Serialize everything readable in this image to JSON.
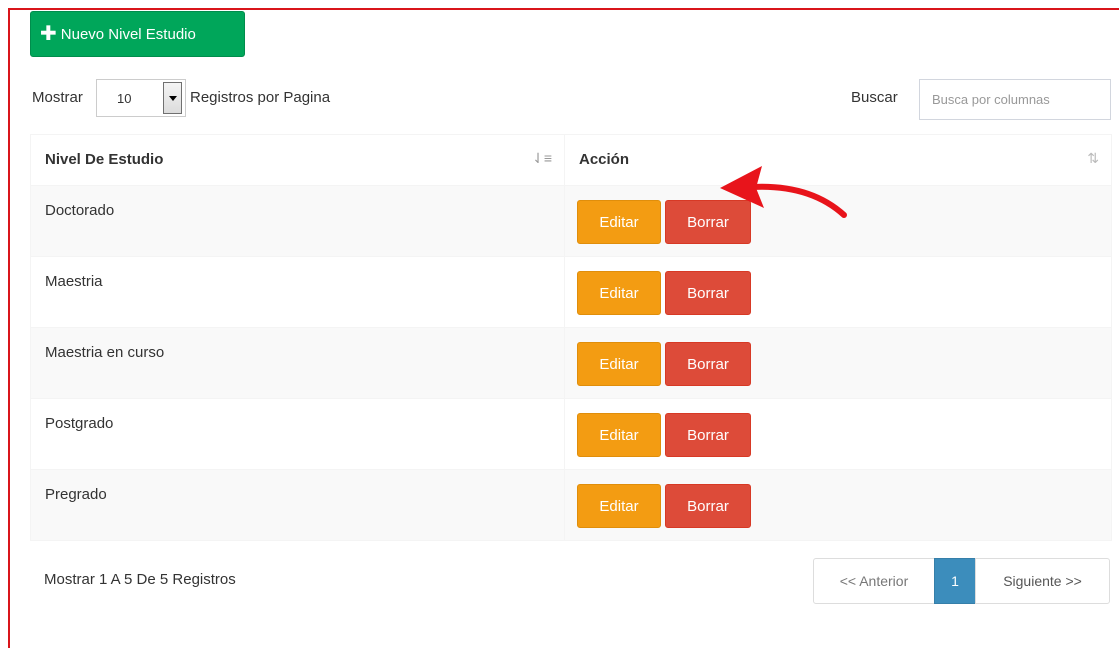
{
  "toolbar": {
    "new_button_label": "Nuevo Nivel Estudio",
    "new_button_icon": "plus-icon"
  },
  "length_control": {
    "prefix": "Mostrar",
    "selected": "10",
    "suffix": "Registros por Pagina"
  },
  "search": {
    "label": "Buscar",
    "placeholder": "Busca por columnas",
    "value": ""
  },
  "table": {
    "columns": [
      {
        "label": "Nivel De Estudio",
        "sort_icon": "sort-amount-asc-icon"
      },
      {
        "label": "Acción",
        "sort_icon": "sort-icon"
      }
    ],
    "rows": [
      {
        "name": "Doctorado",
        "edit": "Editar",
        "delete": "Borrar"
      },
      {
        "name": "Maestria",
        "edit": "Editar",
        "delete": "Borrar"
      },
      {
        "name": "Maestria en curso",
        "edit": "Editar",
        "delete": "Borrar"
      },
      {
        "name": "Postgrado",
        "edit": "Editar",
        "delete": "Borrar"
      },
      {
        "name": "Pregrado",
        "edit": "Editar",
        "delete": "Borrar"
      }
    ]
  },
  "footer": {
    "info": "Mostrar 1 A 5 De 5 Registros"
  },
  "pagination": {
    "prev": "<< Anterior",
    "current": "1",
    "next": "Siguiente >>"
  },
  "colors": {
    "success": "#00a65a",
    "warning": "#f39c12",
    "danger": "#dd4b39",
    "primary": "#3c8dbc",
    "annotation": "#e8141b"
  }
}
